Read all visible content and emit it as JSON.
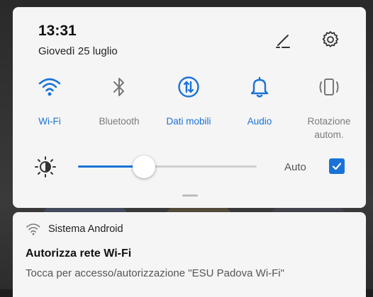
{
  "status": {
    "time": "13:31",
    "date": "Giovedì 25 luglio"
  },
  "header_icons": [
    "edit-icon",
    "gear-icon"
  ],
  "tiles": [
    {
      "label": "Wi-Fi",
      "icon": "wifi-icon",
      "active": true
    },
    {
      "label": "Bluetooth",
      "icon": "bluetooth-icon",
      "active": false
    },
    {
      "label": "Dati mobili",
      "icon": "mobile-data-icon",
      "active": true
    },
    {
      "label": "Audio",
      "icon": "bell-icon",
      "active": true
    },
    {
      "label": "Rotazione autom.",
      "icon": "rotation-icon",
      "active": false
    }
  ],
  "brightness": {
    "level": 0.37,
    "auto_label": "Auto",
    "auto_checked": true
  },
  "notification": {
    "app_name": "Sistema Android",
    "app_icon": "wifi-icon",
    "title": "Autorizza rete Wi-Fi",
    "body": "Tocca per accesso/autorizzazione \"ESU Padova Wi-Fi\""
  },
  "colors": {
    "accent": "#1a72d8",
    "inactive": "#7a7a7a",
    "panel_bg": "#f5f5f5"
  }
}
